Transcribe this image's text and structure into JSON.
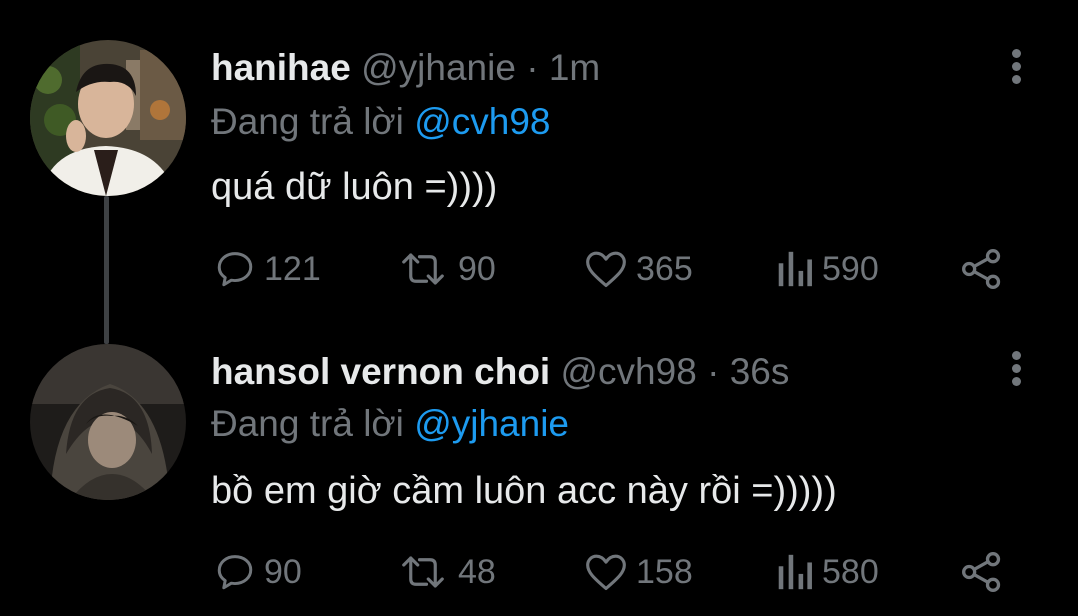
{
  "tweets": [
    {
      "display_name": "hanihae",
      "handle": "@yjhanie",
      "separator": "·",
      "time": "1m",
      "reply_prefix": "Đang trả lời",
      "reply_to": "@cvh98",
      "text": "quá dữ luôn =))))",
      "stats": {
        "replies": "121",
        "retweets": "90",
        "likes": "365",
        "views": "590"
      }
    },
    {
      "display_name": "hansol vernon choi",
      "handle": "@cvh98",
      "separator": "·",
      "time": "36s",
      "reply_prefix": "Đang trả lời",
      "reply_to": "@yjhanie",
      "text": "bồ em giờ cầm luôn acc này rồi =)))))",
      "stats": {
        "replies": "90",
        "retweets": "48",
        "likes": "158",
        "views": "580"
      }
    }
  ],
  "icons": {
    "reply": "comment-bubble-icon",
    "retweet": "retweet-icon",
    "like": "heart-icon",
    "views": "bar-chart-icon",
    "share": "share-icon",
    "more": "vertical-dots-icon"
  },
  "colors": {
    "background": "#000000",
    "primary_text": "#e7e9ea",
    "secondary_text": "#71767b",
    "mention": "#1d9bf0",
    "thread_line": "#3e4144"
  }
}
